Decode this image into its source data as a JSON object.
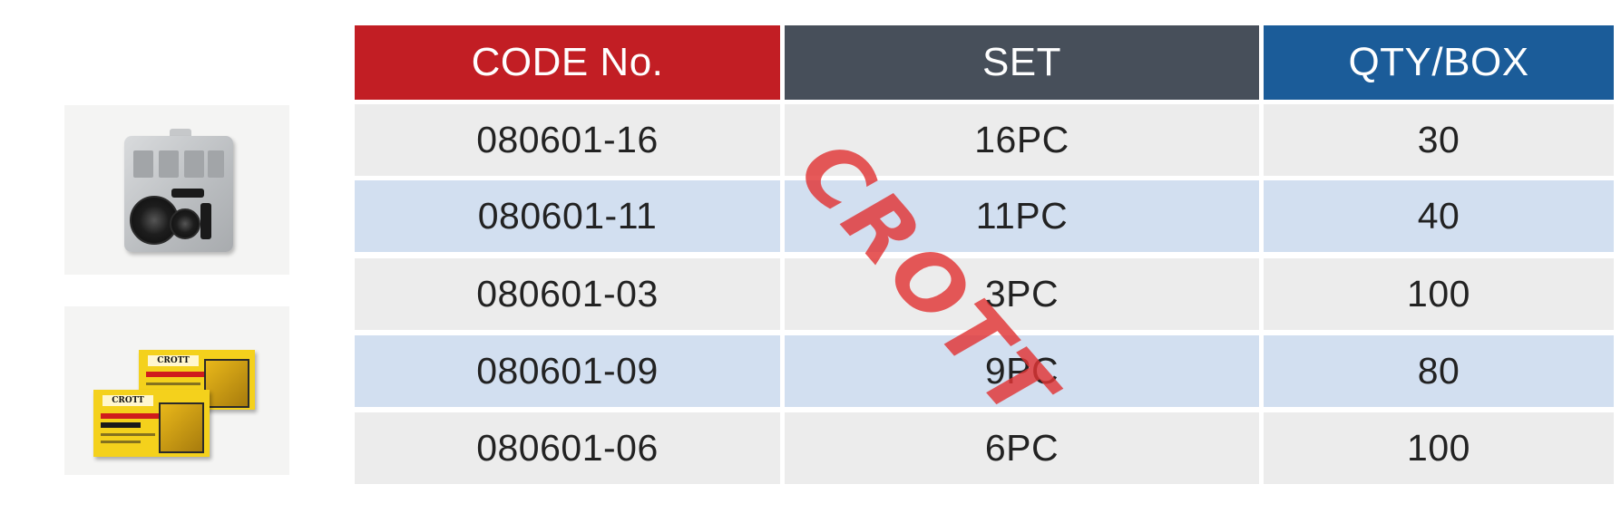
{
  "table": {
    "headers": {
      "code": "CODE No.",
      "set": "SET",
      "qty": "QTY/BOX"
    },
    "rows": [
      {
        "code": "080601-16",
        "set": "16PC",
        "qty": "30"
      },
      {
        "code": "080601-11",
        "set": "11PC",
        "qty": "40"
      },
      {
        "code": "080601-03",
        "set": "3PC",
        "qty": "100"
      },
      {
        "code": "080601-09",
        "set": "9PC",
        "qty": "80"
      },
      {
        "code": "080601-06",
        "set": "6PC",
        "qty": "100"
      }
    ],
    "colors": {
      "code_header": "#c21e24",
      "set_header": "#474f5a",
      "qty_header": "#1b5c99",
      "row_light": "#ececec",
      "row_blue": "#d2dff0"
    }
  },
  "watermark": {
    "text": "CROTT",
    "color": "#e03434"
  },
  "photos": {
    "box_brand": "CROTT"
  }
}
